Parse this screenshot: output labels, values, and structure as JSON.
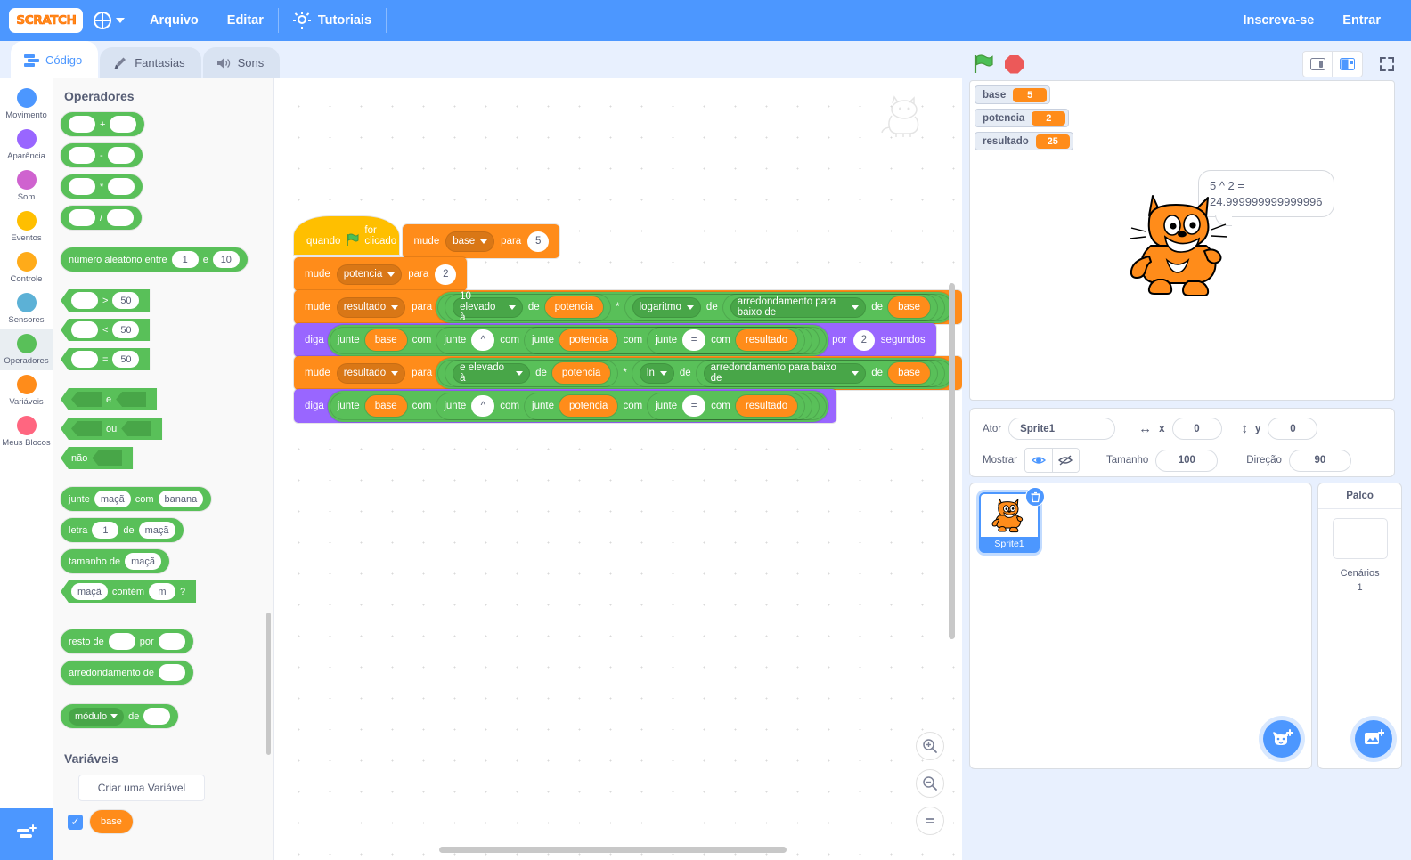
{
  "menubar": {
    "logo_text": "SCRATCH",
    "globe_icon": "globe-icon",
    "items": [
      "Arquivo",
      "Editar"
    ],
    "tutorials": "Tutoriais",
    "signup": "Inscreva-se",
    "signin": "Entrar"
  },
  "tabs": [
    {
      "label": "Código",
      "icon": "code-icon",
      "active": true
    },
    {
      "label": "Fantasias",
      "icon": "brush-icon",
      "active": false
    },
    {
      "label": "Sons",
      "icon": "speaker-icon",
      "active": false
    }
  ],
  "categories": [
    {
      "label": "Movimento",
      "color": "#4c97ff"
    },
    {
      "label": "Aparência",
      "color": "#9966ff"
    },
    {
      "label": "Som",
      "color": "#cf63cf"
    },
    {
      "label": "Eventos",
      "color": "#ffbf00"
    },
    {
      "label": "Controle",
      "color": "#ffab19"
    },
    {
      "label": "Sensores",
      "color": "#5cb1d6"
    },
    {
      "label": "Operadores",
      "color": "#59c059"
    },
    {
      "label": "Variáveis",
      "color": "#ff8c1a"
    },
    {
      "label": "Meus Blocos",
      "color": "#ff6680"
    }
  ],
  "palette": {
    "heading_operators": "Operadores",
    "heading_variables": "Variáveis",
    "arith": [
      "+",
      "-",
      "*",
      "/"
    ],
    "random": {
      "prefix": "número aleatório entre",
      "from": "1",
      "mid": "e",
      "to": "10"
    },
    "compare": [
      {
        "op": ">",
        "value": "50"
      },
      {
        "op": "<",
        "value": "50"
      },
      {
        "op": "=",
        "value": "50"
      }
    ],
    "logic": [
      "e",
      "ou"
    ],
    "not": "não",
    "join": {
      "label": "junte",
      "a": "maçã",
      "mid": "com",
      "b": "banana"
    },
    "letter": {
      "l1": "letra",
      "n": "1",
      "l2": "de",
      "s": "maçã"
    },
    "length": {
      "label": "tamanho de",
      "s": "maçã"
    },
    "contains": {
      "s": "maçã",
      "label": "contém",
      "c": "m",
      "q": "?"
    },
    "mod": {
      "l1": "resto de",
      "l2": "por"
    },
    "round": {
      "label": "arredondamento de"
    },
    "mathop": {
      "fn": "módulo",
      "de": "de"
    },
    "create_var": "Criar uma Variável",
    "var_base": "base"
  },
  "scripts": {
    "hat": {
      "pre": "quando",
      "post": "for clicado",
      "icon": "green-flag-icon"
    },
    "set_base": {
      "verb": "mude",
      "var": "base",
      "to": "para",
      "value": "5"
    },
    "set_potencia": {
      "verb": "mude",
      "var": "potencia",
      "to": "para",
      "value": "2"
    },
    "set_resultado_log10": {
      "verb": "mude",
      "var": "resultado",
      "to": "para",
      "fn_outer": "10 elevado à",
      "de": "de",
      "arg_outer": "potencia",
      "times": "*",
      "fn_inner": "logaritmo",
      "de2": "de",
      "fn_round": "arredondamento para baixo de",
      "de3": "de",
      "arg_inner": "base"
    },
    "say1": {
      "verb": "diga",
      "join": "junte",
      "com": "com",
      "a": "base",
      "caret": "^",
      "b": "potencia",
      "eq": "=",
      "c": "resultado",
      "por": "por",
      "secs": "2",
      "segundos": "segundos"
    },
    "set_resultado_ln": {
      "verb": "mude",
      "var": "resultado",
      "to": "para",
      "fn_outer": "e elevado à",
      "de": "de",
      "arg_outer": "potencia",
      "times": "*",
      "fn_inner": "ln",
      "de2": "de",
      "fn_round": "arredondamento para baixo de",
      "de3": "de",
      "arg_inner": "base"
    },
    "say2": {
      "verb": "diga",
      "join": "junte",
      "com": "com",
      "a": "base",
      "caret": "^",
      "b": "potencia",
      "eq": "=",
      "c": "resultado"
    }
  },
  "stage": {
    "monitors": [
      {
        "name": "base",
        "value": "5"
      },
      {
        "name": "potencia",
        "value": "2"
      },
      {
        "name": "resultado",
        "value": "25"
      }
    ],
    "bubble_line1": "5 ^ 2 =",
    "bubble_line2": "24.999999999999996"
  },
  "sprite_info": {
    "actor_label": "Ator",
    "name": "Sprite1",
    "x_label": "x",
    "x_value": "0",
    "y_label": "y",
    "y_value": "0",
    "show_label": "Mostrar",
    "size_label": "Tamanho",
    "size_value": "100",
    "direction_label": "Direção",
    "direction_value": "90"
  },
  "sprite_list": [
    {
      "name": "Sprite1"
    }
  ],
  "stage_panel": {
    "title": "Palco",
    "backdrops_label": "Cenários",
    "backdrops_count": "1"
  },
  "canvas_controls": {
    "zoom_in": "zoom-in-icon",
    "zoom_out": "zoom-out-icon",
    "zoom_reset": "zoom-reset-icon"
  },
  "colors": {
    "brand_blue": "#4c97ff",
    "operator_green": "#59c059",
    "variable_orange": "#ff8c1a",
    "looks_purple": "#9966ff",
    "events_yellow": "#ffbf00",
    "stop_red": "#ec5959"
  }
}
